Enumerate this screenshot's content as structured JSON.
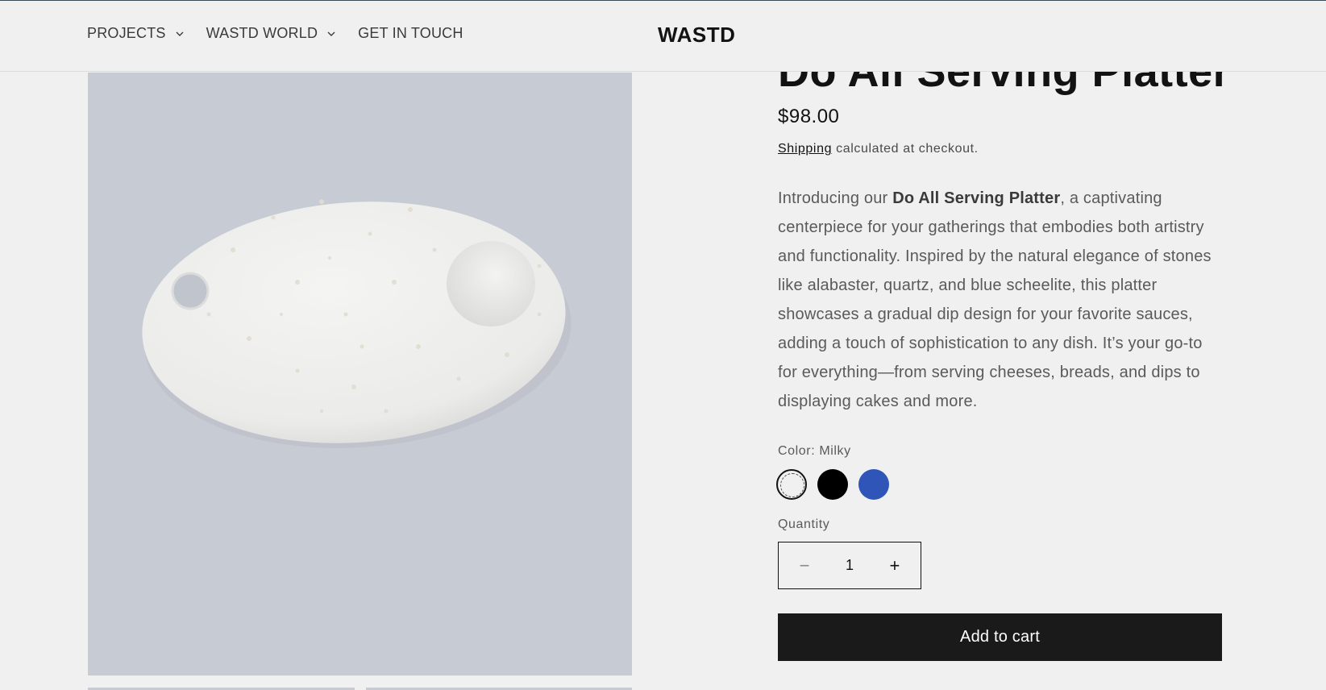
{
  "header": {
    "brand": "WASTD",
    "nav": [
      {
        "label": "PROJECTS",
        "icon": "chevron-down-icon"
      },
      {
        "label": "WASTD WORLD",
        "icon": "chevron-down-icon"
      },
      {
        "label": "GET IN TOUCH"
      }
    ]
  },
  "product": {
    "title": "Do All Serving Platter",
    "price": "$98.00",
    "shipping_link": "Shipping",
    "shipping_text": " calculated at checkout.",
    "description": {
      "intro": "Introducing our ",
      "name": "Do All Serving Platter",
      "rest": ", a captivating centerpiece for your gatherings that embodies both artistry and functionality. Inspired by the natural elegance of stones like alabaster, quartz, and blue scheelite, this platter showcases a gradual dip design for your favorite sauces, adding a touch of sophistication to any dish. It’s your go-to for everything—from serving cheeses, breads, and dips to displaying cakes and more."
    },
    "color_label": "Color: Milky",
    "swatches": [
      {
        "name": "Milky",
        "color": "#f0f0f0",
        "selected": true
      },
      {
        "name": "Black",
        "color": "#000000",
        "selected": false
      },
      {
        "name": "Blue",
        "color": "#2f55b8",
        "selected": false
      }
    ],
    "quantity_label": "Quantity",
    "quantity": "1",
    "minus_symbol": "−",
    "plus_symbol": "+",
    "add_to_cart": "Add to cart"
  },
  "colors": {
    "image_bg": "#c7cbd3",
    "button_bg": "#1a1a1a"
  }
}
